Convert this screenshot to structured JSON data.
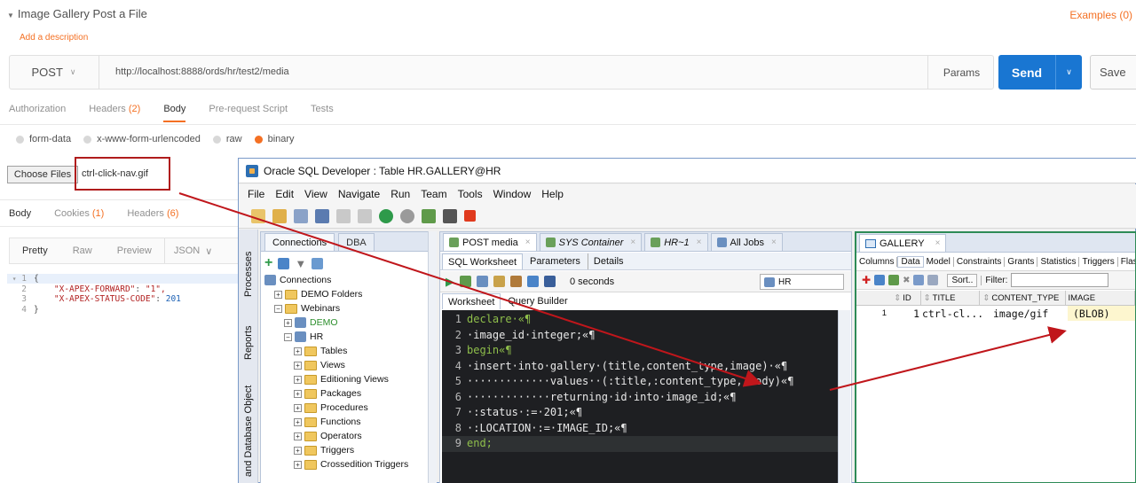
{
  "postman": {
    "title": "Image Gallery Post a File",
    "add_description": "Add a description",
    "examples": "Examples (0)",
    "method": "POST",
    "url": "http://localhost:8888/ords/hr/test2/media",
    "params": "Params",
    "send": "Send",
    "save": "Save",
    "req_tabs": [
      "Authorization",
      "Headers",
      "Body",
      "Pre-request Script",
      "Tests"
    ],
    "headers_count": "(2)",
    "body_types": [
      "form-data",
      "x-www-form-urlencoded",
      "raw",
      "binary"
    ],
    "choose_files": "Choose Files",
    "file_name": "ctrl-click-nav.gif",
    "resp_tabs": [
      "Body",
      "Cookies",
      "Headers"
    ],
    "cookies_count": "(1)",
    "resp_headers_count": "(6)",
    "view_modes": [
      "Pretty",
      "Raw",
      "Preview"
    ],
    "format": "JSON",
    "json_lines": [
      {
        "n": "1",
        "t": "{"
      },
      {
        "n": "2",
        "k": "\"X-APEX-FORWARD\"",
        "v": "\"1\","
      },
      {
        "n": "3",
        "k": "\"X-APEX-STATUS-CODE\"",
        "v": "201"
      },
      {
        "n": "4",
        "t": "}"
      }
    ]
  },
  "sqldev": {
    "window_title": "Oracle SQL Developer : Table HR.GALLERY@HR",
    "menu": [
      "File",
      "Edit",
      "View",
      "Navigate",
      "Run",
      "Team",
      "Tools",
      "Window",
      "Help"
    ],
    "side_tabs": [
      "Processes",
      "Reports",
      "and Database Object"
    ],
    "conn_tabs": [
      "Connections",
      "DBA"
    ],
    "tree": [
      {
        "label": "Connections",
        "level": 0,
        "icon": "connections"
      },
      {
        "label": "DEMO Folders",
        "level": 1,
        "icon": "folder"
      },
      {
        "label": "Webinars",
        "level": 1,
        "icon": "folder"
      },
      {
        "label": "DEMO",
        "level": 2,
        "icon": "db"
      },
      {
        "label": "HR",
        "level": 2,
        "icon": "db"
      },
      {
        "label": "Tables",
        "level": 3,
        "icon": "folder"
      },
      {
        "label": "Views",
        "level": 3,
        "icon": "folder"
      },
      {
        "label": "Editioning Views",
        "level": 3,
        "icon": "folder"
      },
      {
        "label": "Packages",
        "level": 3,
        "icon": "folder"
      },
      {
        "label": "Procedures",
        "level": 3,
        "icon": "folder"
      },
      {
        "label": "Functions",
        "level": 3,
        "icon": "folder"
      },
      {
        "label": "Operators",
        "level": 3,
        "icon": "folder"
      },
      {
        "label": "Triggers",
        "level": 3,
        "icon": "folder"
      },
      {
        "label": "Crossedition Triggers",
        "level": 3,
        "icon": "folder"
      }
    ],
    "editor_tabs": [
      "POST media",
      "SYS Container",
      "HR~1",
      "All Jobs"
    ],
    "sub_tabs": [
      "SQL Worksheet",
      "Parameters",
      "Details"
    ],
    "timing": "0 seconds",
    "connection": "HR",
    "ws_tabs": [
      "Worksheet",
      "Query Builder"
    ],
    "code_lines": [
      {
        "n": "1",
        "t": "declare·«¶"
      },
      {
        "n": "2",
        "t": "·image_id·integer;«¶"
      },
      {
        "n": "3",
        "t": "begin«¶"
      },
      {
        "n": "4",
        "t": "·insert·into·gallery·(title,content_type,image)·«¶"
      },
      {
        "n": "5",
        "t": "·············values··(:title,:content_type,:body)«¶"
      },
      {
        "n": "6",
        "t": "·············returning·id·into·image_id;«¶"
      },
      {
        "n": "7",
        "t": "·:status·:=·201;«¶"
      },
      {
        "n": "8",
        "t": "·:LOCATION·:=·IMAGE_ID;«¶"
      },
      {
        "n": "9",
        "t": "end;"
      }
    ],
    "gallery_tab": "GALLERY",
    "gallery_subtabs": [
      "Columns",
      "Data",
      "Model",
      "Constraints",
      "Grants",
      "Statistics",
      "Triggers",
      "Flas"
    ],
    "sort": "Sort..",
    "filter": "Filter:",
    "columns": [
      "ID",
      "TITLE",
      "CONTENT_TYPE",
      "IMAGE"
    ],
    "row": {
      "rownum": "1",
      "id": "1",
      "title": "ctrl-cl...",
      "content_type": "image/gif",
      "image": "(BLOB)"
    }
  },
  "colors": {
    "accent": "#f47023",
    "send": "#1976d2",
    "arrow": "#c0161b"
  }
}
